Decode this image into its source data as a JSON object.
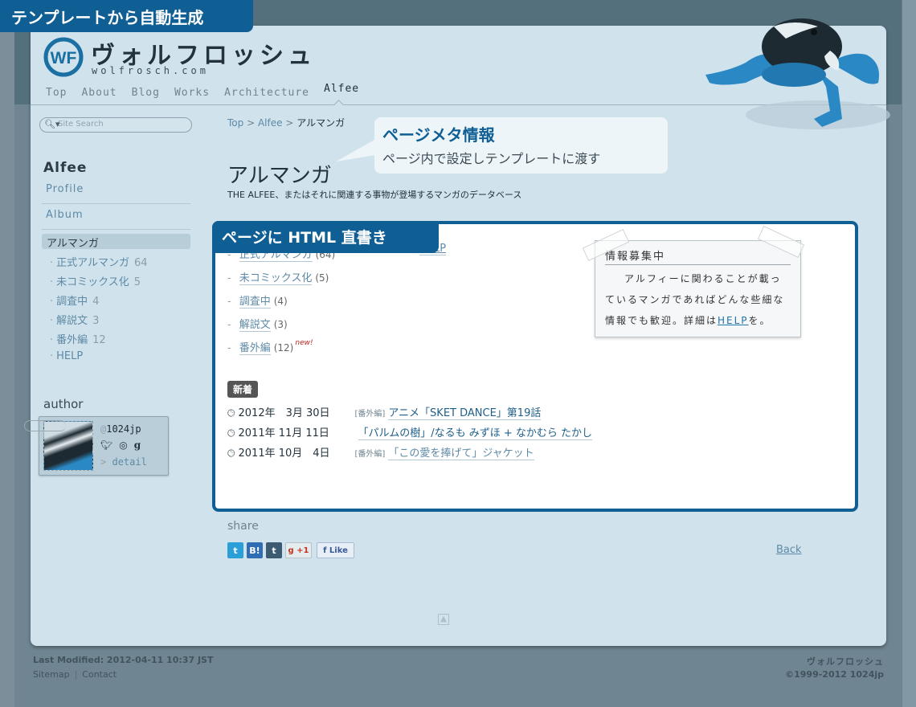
{
  "annotations": {
    "template_label": "テンプレートから自動生成",
    "meta_title": "ページメタ情報",
    "meta_sub": "ページ内で設定しテンプレートに渡す",
    "html_label": "ページに HTML 直書き"
  },
  "site": {
    "logo_text": "WF",
    "name": "ヴォルフロッシュ",
    "url": "wolfrosch.com"
  },
  "nav": [
    {
      "label": "Top"
    },
    {
      "label": "About"
    },
    {
      "label": "Blog"
    },
    {
      "label": "Works"
    },
    {
      "label": "Architecture"
    },
    {
      "label": "Alfee",
      "active": true
    }
  ],
  "sidebar": {
    "search_placeholder": "Site Search",
    "section_title": "Alfee",
    "links": [
      {
        "label": "Profile"
      },
      {
        "label": "Album"
      }
    ],
    "current": "アルマンガ",
    "sub_items": [
      {
        "label": "正式アルマンガ",
        "count": "64"
      },
      {
        "label": "未コミックス化",
        "count": "5"
      },
      {
        "label": "調査中",
        "count": "4"
      },
      {
        "label": "解説文",
        "count": "3"
      },
      {
        "label": "番外編",
        "count": "12"
      },
      {
        "label": "HELP",
        "count": ""
      }
    ],
    "author": {
      "title": "author",
      "at": "@",
      "handle": "1024jp",
      "sns_icons": [
        "twitter-icon",
        "dribbble-icon",
        "github-icon"
      ],
      "detail_prefix": ">",
      "detail_label": "detail"
    }
  },
  "breadcrumb": [
    {
      "label": "Top"
    },
    {
      "label": "Alfee"
    },
    {
      "label": "アルマンガ"
    }
  ],
  "breadcrumb_sep": ">",
  "page": {
    "title": "アルマンガ",
    "description": "THE ALFEE、またはそれに関連する事物が登場するマンガのデータベース"
  },
  "categories": [
    {
      "label": "正式アルマンガ",
      "count": "(64)",
      "new": ""
    },
    {
      "label": "未コミックス化",
      "count": "(5)",
      "new": ""
    },
    {
      "label": "調査中",
      "count": "(4)",
      "new": ""
    },
    {
      "label": "解説文",
      "count": "(3)",
      "new": ""
    },
    {
      "label": "番外編",
      "count": "(12)",
      "new": "new!"
    }
  ],
  "help_link": "HELP",
  "note": {
    "title": "情報募集中",
    "body_pre": "アルフィーに関わることが載っているマンガであればどんな些細な情報でも歓迎。詳細は",
    "body_link": "HELP",
    "body_post": "を。"
  },
  "news": {
    "badge": "新着",
    "items": [
      {
        "date": "2012年　3月 30日",
        "tag": "[番外編]",
        "title": "アニメ「SKET DANCE」第19話"
      },
      {
        "date": "2011年 11月 11日",
        "tag": "",
        "title": "「パルムの樹」/なるも みずほ + なかむら たかし"
      },
      {
        "date": "2011年 10月　4日",
        "tag": "[番外編]",
        "title": "「この愛を捧げて」ジャケット"
      }
    ]
  },
  "share": {
    "title": "share",
    "buttons": {
      "twitter": "t",
      "hatena": "B!",
      "tumblr": "t",
      "gplus": "g +1",
      "facebook": "f Like"
    }
  },
  "back_label": "Back",
  "footer": {
    "last_modified": "Last Modified: 2012-04-11 10:37 JST",
    "sitemap": "Sitemap",
    "contact": "Contact",
    "site_name": "ヴォルフロッシュ",
    "copyright": "©1999-2012 1024jp"
  },
  "colors": {
    "accent": "#0f5f94",
    "link": "#5e8aa6",
    "page_bg": "#d0e2ec",
    "outer_bg": "#6f8591"
  }
}
